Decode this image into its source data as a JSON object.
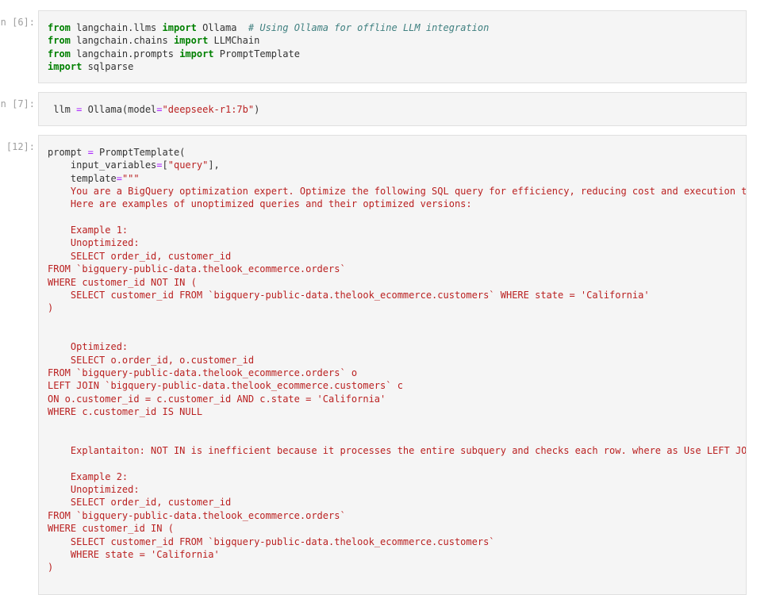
{
  "cells": [
    {
      "prompt": "n [6]:",
      "lines": [
        [
          {
            "t": "from",
            "c": "kw"
          },
          {
            "t": " langchain.llms ",
            "c": "plain"
          },
          {
            "t": "import",
            "c": "kw"
          },
          {
            "t": " Ollama  ",
            "c": "plain"
          },
          {
            "t": "# Using Ollama for offline LLM integration",
            "c": "cm"
          }
        ],
        [
          {
            "t": "from",
            "c": "kw"
          },
          {
            "t": " langchain.chains ",
            "c": "plain"
          },
          {
            "t": "import",
            "c": "kw"
          },
          {
            "t": " LLMChain",
            "c": "plain"
          }
        ],
        [
          {
            "t": "from",
            "c": "kw"
          },
          {
            "t": " langchain.prompts ",
            "c": "plain"
          },
          {
            "t": "import",
            "c": "kw"
          },
          {
            "t": " PromptTemplate",
            "c": "plain"
          }
        ],
        [
          {
            "t": "import",
            "c": "kw"
          },
          {
            "t": " sqlparse",
            "c": "plain"
          }
        ]
      ]
    },
    {
      "prompt": "n [7]:",
      "lines": [
        [
          {
            "t": " llm ",
            "c": "plain"
          },
          {
            "t": "=",
            "c": "op"
          },
          {
            "t": " Ollama(model",
            "c": "plain"
          },
          {
            "t": "=",
            "c": "op"
          },
          {
            "t": "\"deepseek-r1:7b\"",
            "c": "str"
          },
          {
            "t": ")",
            "c": "plain"
          }
        ]
      ]
    },
    {
      "prompt": "[12]:",
      "lines": [
        [
          {
            "t": "prompt ",
            "c": "plain"
          },
          {
            "t": "=",
            "c": "op"
          },
          {
            "t": " PromptTemplate(",
            "c": "plain"
          }
        ],
        [
          {
            "t": "    input_variables",
            "c": "plain"
          },
          {
            "t": "=",
            "c": "op"
          },
          {
            "t": "[",
            "c": "plain"
          },
          {
            "t": "\"query\"",
            "c": "str"
          },
          {
            "t": "],",
            "c": "plain"
          }
        ],
        [
          {
            "t": "    template",
            "c": "plain"
          },
          {
            "t": "=",
            "c": "op"
          },
          {
            "t": "\"\"\"",
            "c": "str"
          }
        ],
        [
          {
            "t": "    You are a BigQuery optimization expert. Optimize the following SQL query for efficiency, reducing cost and execution tir",
            "c": "str"
          }
        ],
        [
          {
            "t": "    Here are examples of unoptimized queries and their optimized versions:",
            "c": "str"
          }
        ],
        [
          {
            "t": "",
            "c": "str"
          }
        ],
        [
          {
            "t": "    Example 1:",
            "c": "str"
          }
        ],
        [
          {
            "t": "    Unoptimized:",
            "c": "str"
          }
        ],
        [
          {
            "t": "    SELECT order_id, customer_id",
            "c": "str"
          }
        ],
        [
          {
            "t": "FROM `bigquery-public-data.thelook_ecommerce.orders`",
            "c": "str"
          }
        ],
        [
          {
            "t": "WHERE customer_id NOT IN (",
            "c": "str"
          }
        ],
        [
          {
            "t": "    SELECT customer_id FROM `bigquery-public-data.thelook_ecommerce.customers` WHERE state = 'California'",
            "c": "str"
          }
        ],
        [
          {
            "t": ")",
            "c": "str"
          }
        ],
        [
          {
            "t": "",
            "c": "str"
          }
        ],
        [
          {
            "t": "",
            "c": "str"
          }
        ],
        [
          {
            "t": "    Optimized:",
            "c": "str"
          }
        ],
        [
          {
            "t": "    SELECT o.order_id, o.customer_id",
            "c": "str"
          }
        ],
        [
          {
            "t": "FROM `bigquery-public-data.thelook_ecommerce.orders` o",
            "c": "str"
          }
        ],
        [
          {
            "t": "LEFT JOIN `bigquery-public-data.thelook_ecommerce.customers` c",
            "c": "str"
          }
        ],
        [
          {
            "t": "ON o.customer_id = c.customer_id AND c.state = 'California'",
            "c": "str"
          }
        ],
        [
          {
            "t": "WHERE c.customer_id IS NULL",
            "c": "str"
          }
        ],
        [
          {
            "t": "",
            "c": "str"
          }
        ],
        [
          {
            "t": "",
            "c": "str"
          }
        ],
        [
          {
            "t": "    Explantaiton: NOT IN is inefficient because it processes the entire subquery and checks each row. where as Use LEFT JOIN",
            "c": "str"
          }
        ],
        [
          {
            "t": "",
            "c": "str"
          }
        ],
        [
          {
            "t": "    Example 2:",
            "c": "str"
          }
        ],
        [
          {
            "t": "    Unoptimized:",
            "c": "str"
          }
        ],
        [
          {
            "t": "    SELECT order_id, customer_id",
            "c": "str"
          }
        ],
        [
          {
            "t": "FROM `bigquery-public-data.thelook_ecommerce.orders`",
            "c": "str"
          }
        ],
        [
          {
            "t": "WHERE customer_id IN (",
            "c": "str"
          }
        ],
        [
          {
            "t": "    SELECT customer_id FROM `bigquery-public-data.thelook_ecommerce.customers`",
            "c": "str"
          }
        ],
        [
          {
            "t": "    WHERE state = 'California'",
            "c": "str"
          }
        ],
        [
          {
            "t": ")",
            "c": "str"
          }
        ]
      ]
    }
  ],
  "colors": {
    "keyword": "#008000",
    "comment": "#408080",
    "string": "#ba2121",
    "operator": "#aa22ff",
    "cell_bg": "#f5f5f5",
    "prompt": "#9e9e9e"
  }
}
